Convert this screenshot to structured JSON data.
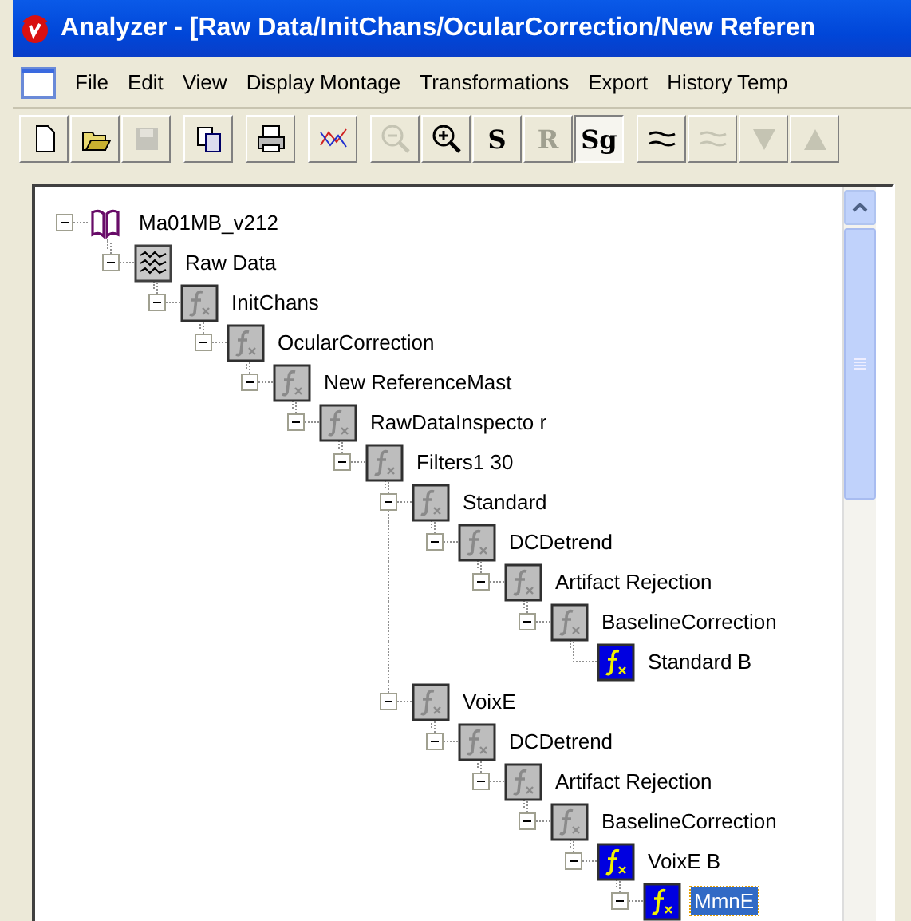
{
  "window": {
    "title": "Analyzer - [Raw Data/InitChans/OcularCorrection/New Referen"
  },
  "menu": [
    "File",
    "Edit",
    "View",
    "Display Montage",
    "Transformations",
    "Export",
    "History Temp"
  ],
  "toolbar": [
    [
      {
        "kind": "new",
        "disabled": false,
        "pressed": false
      },
      {
        "kind": "open",
        "disabled": false,
        "pressed": false
      },
      {
        "kind": "save",
        "disabled": true,
        "pressed": false
      }
    ],
    [
      {
        "kind": "copy",
        "disabled": false,
        "pressed": false
      }
    ],
    [
      {
        "kind": "print",
        "disabled": false,
        "pressed": false
      }
    ],
    [
      {
        "kind": "chart",
        "disabled": false,
        "pressed": false
      }
    ],
    [
      {
        "kind": "zoom-out",
        "disabled": true,
        "pressed": false
      },
      {
        "kind": "zoom-in",
        "disabled": false,
        "pressed": false
      },
      {
        "kind": "text",
        "label": "S",
        "disabled": false,
        "pressed": false
      },
      {
        "kind": "text",
        "label": "R",
        "disabled": true,
        "pressed": false
      },
      {
        "kind": "text",
        "label": "Sg",
        "disabled": false,
        "pressed": true
      }
    ],
    [
      {
        "kind": "lines",
        "disabled": false,
        "pressed": false
      },
      {
        "kind": "lines",
        "disabled": true,
        "pressed": false
      },
      {
        "kind": "down",
        "disabled": true,
        "pressed": false
      },
      {
        "kind": "up",
        "disabled": true,
        "pressed": false
      }
    ]
  ],
  "tree": [
    {
      "label": "Ma01MB_v212",
      "kind": "book",
      "active": false,
      "selected": false,
      "expanded": true,
      "children": [
        {
          "label": "Raw Data",
          "kind": "raw",
          "active": false,
          "selected": false,
          "expanded": true,
          "children": [
            {
              "label": "InitChans",
              "kind": "transform",
              "active": false,
              "selected": false,
              "expanded": true,
              "children": [
                {
                  "label": "OcularCorrection",
                  "kind": "transform",
                  "active": false,
                  "selected": false,
                  "expanded": true,
                  "children": [
                    {
                      "label": "New ReferenceMast",
                      "kind": "transform",
                      "active": false,
                      "selected": false,
                      "expanded": true,
                      "children": [
                        {
                          "label": "RawDataInspecto r",
                          "kind": "transform",
                          "active": false,
                          "selected": false,
                          "expanded": true,
                          "children": [
                            {
                              "label": "Filters1 30",
                              "kind": "transform",
                              "active": false,
                              "selected": false,
                              "expanded": true,
                              "children": [
                                {
                                  "label": "Standard",
                                  "kind": "transform",
                                  "active": false,
                                  "selected": false,
                                  "expanded": true,
                                  "children": [
                                    {
                                      "label": "DCDetrend",
                                      "kind": "transform",
                                      "active": false,
                                      "selected": false,
                                      "expanded": true,
                                      "children": [
                                        {
                                          "label": "Artifact Rejection",
                                          "kind": "transform",
                                          "active": false,
                                          "selected": false,
                                          "expanded": true,
                                          "children": [
                                            {
                                              "label": "BaselineCorrection",
                                              "kind": "transform",
                                              "active": false,
                                              "selected": false,
                                              "expanded": true,
                                              "children": [
                                                {
                                                  "label": "Standard B",
                                                  "kind": "transform",
                                                  "active": true,
                                                  "selected": false
                                                }
                                              ]
                                            }
                                          ]
                                        }
                                      ]
                                    }
                                  ]
                                },
                                {
                                  "label": "VoixE",
                                  "kind": "transform",
                                  "active": false,
                                  "selected": false,
                                  "expanded": true,
                                  "children": [
                                    {
                                      "label": "DCDetrend",
                                      "kind": "transform",
                                      "active": false,
                                      "selected": false,
                                      "expanded": true,
                                      "children": [
                                        {
                                          "label": "Artifact Rejection",
                                          "kind": "transform",
                                          "active": false,
                                          "selected": false,
                                          "expanded": true,
                                          "children": [
                                            {
                                              "label": "BaselineCorrection",
                                              "kind": "transform",
                                              "active": false,
                                              "selected": false,
                                              "expanded": true,
                                              "children": [
                                                {
                                                  "label": "VoixE B",
                                                  "kind": "transform",
                                                  "active": true,
                                                  "selected": false,
                                                  "expanded": true,
                                                  "children": [
                                                    {
                                                      "label": "MmnE",
                                                      "kind": "transform",
                                                      "active": true,
                                                      "selected": true,
                                                      "expanded": true
                                                    }
                                                  ]
                                                }
                                              ]
                                            }
                                          ]
                                        }
                                      ]
                                    }
                                  ]
                                }
                              ]
                            }
                          ]
                        }
                      ]
                    }
                  ]
                }
              ]
            }
          ]
        }
      ]
    }
  ]
}
